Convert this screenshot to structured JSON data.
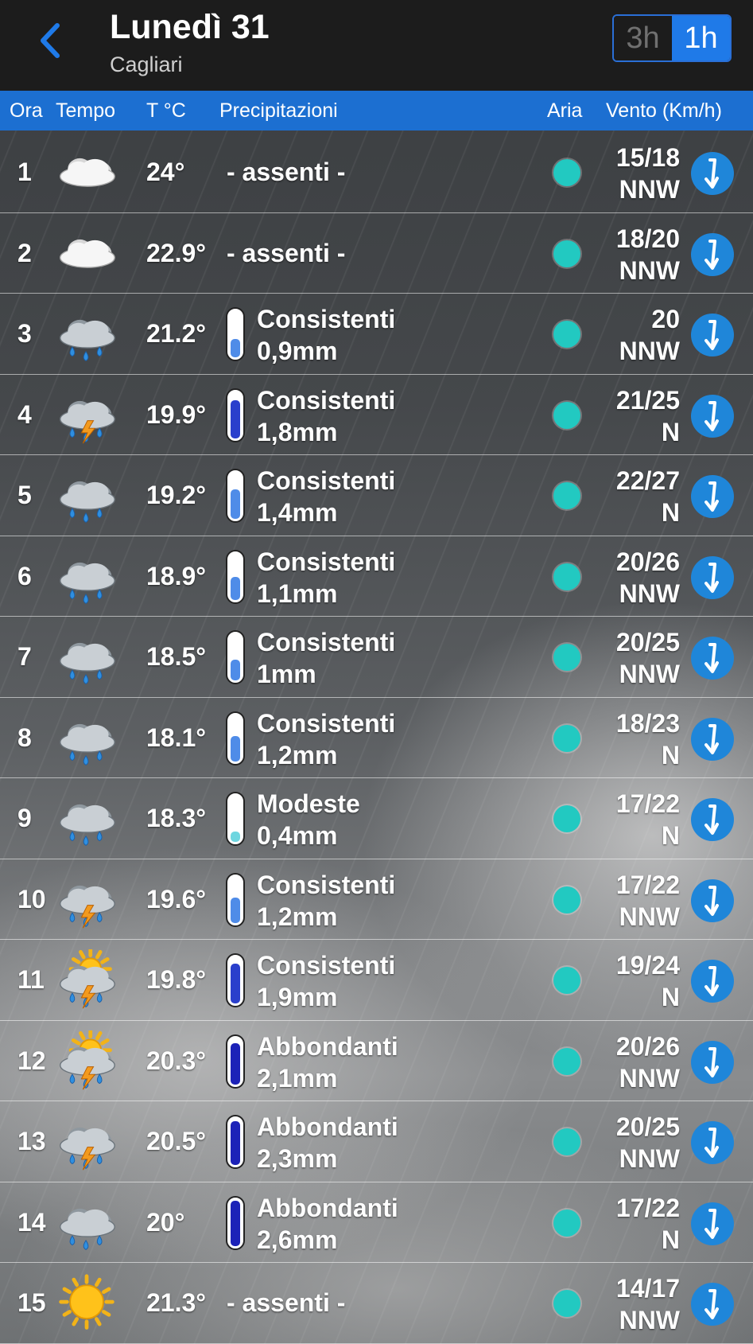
{
  "header": {
    "title": "Lunedì 31",
    "subtitle": "Cagliari",
    "interval_3h": "3h",
    "interval_1h": "1h",
    "selected_interval": "1h"
  },
  "columns": {
    "hour": "Ora",
    "weather": "Tempo",
    "temp": "T °C",
    "precip": "Precipitazioni",
    "air": "Aria",
    "wind": "Vento (Km/h)"
  },
  "colors": {
    "accent": "#1f7ae8",
    "header_bar": "#1c6fd1",
    "air_quality_good": "#22c9c1",
    "wind_badge": "#1f86d9"
  },
  "rows": [
    {
      "hour": "1",
      "icon": "cloudy-icon",
      "temp": "24°",
      "precip_label": "- assenti -",
      "precip_amount": "",
      "level": 0,
      "wind_speed": "15/18",
      "wind_dir": "NNW"
    },
    {
      "hour": "2",
      "icon": "cloudy-icon",
      "temp": "22.9°",
      "precip_label": "- assenti -",
      "precip_amount": "",
      "level": 0,
      "wind_speed": "18/20",
      "wind_dir": "NNW"
    },
    {
      "hour": "3",
      "icon": "rain-icon",
      "temp": "21.2°",
      "precip_label": "Consistenti",
      "precip_amount": "0,9mm",
      "level": 0.4,
      "wind_speed": "20",
      "wind_dir": "NNW"
    },
    {
      "hour": "4",
      "icon": "thunderstorm-rain-icon",
      "temp": "19.9°",
      "precip_label": "Consistenti",
      "precip_amount": "1,8mm",
      "level": 0.82,
      "wind_speed": "21/25",
      "wind_dir": "N"
    },
    {
      "hour": "5",
      "icon": "rain-icon",
      "temp": "19.2°",
      "precip_label": "Consistenti",
      "precip_amount": "1,4mm",
      "level": 0.63,
      "wind_speed": "22/27",
      "wind_dir": "N"
    },
    {
      "hour": "6",
      "icon": "rain-icon",
      "temp": "18.9°",
      "precip_label": "Consistenti",
      "precip_amount": "1,1mm",
      "level": 0.5,
      "wind_speed": "20/26",
      "wind_dir": "NNW"
    },
    {
      "hour": "7",
      "icon": "rain-icon",
      "temp": "18.5°",
      "precip_label": "Consistenti",
      "precip_amount": "1mm",
      "level": 0.45,
      "wind_speed": "20/25",
      "wind_dir": "NNW"
    },
    {
      "hour": "8",
      "icon": "rain-icon",
      "temp": "18.1°",
      "precip_label": "Consistenti",
      "precip_amount": "1,2mm",
      "level": 0.55,
      "wind_speed": "18/23",
      "wind_dir": "N"
    },
    {
      "hour": "9",
      "icon": "rain-icon",
      "temp": "18.3°",
      "precip_label": "Modeste",
      "precip_amount": "0,4mm",
      "level": 0.22,
      "wind_speed": "17/22",
      "wind_dir": "N"
    },
    {
      "hour": "10",
      "icon": "thunderstorm-rain-icon",
      "temp": "19.6°",
      "precip_label": "Consistenti",
      "precip_amount": "1,2mm",
      "level": 0.55,
      "wind_speed": "17/22",
      "wind_dir": "NNW"
    },
    {
      "hour": "11",
      "icon": "sun-thunderstorm-rain-icon",
      "temp": "19.8°",
      "precip_label": "Consistenti",
      "precip_amount": "1,9mm",
      "level": 0.86,
      "wind_speed": "19/24",
      "wind_dir": "N"
    },
    {
      "hour": "12",
      "icon": "sun-thunderstorm-rain-icon",
      "temp": "20.3°",
      "precip_label": "Abbondanti",
      "precip_amount": "2,1mm",
      "level": 0.9,
      "wind_speed": "20/26",
      "wind_dir": "NNW"
    },
    {
      "hour": "13",
      "icon": "thunderstorm-rain-icon",
      "temp": "20.5°",
      "precip_label": "Abbondanti",
      "precip_amount": "2,3mm",
      "level": 0.94,
      "wind_speed": "20/25",
      "wind_dir": "NNW"
    },
    {
      "hour": "14",
      "icon": "rain-icon",
      "temp": "20°",
      "precip_label": "Abbondanti",
      "precip_amount": "2,6mm",
      "level": 0.98,
      "wind_speed": "17/22",
      "wind_dir": "N"
    },
    {
      "hour": "15",
      "icon": "sun-icon",
      "temp": "21.3°",
      "precip_label": "- assenti -",
      "precip_amount": "",
      "level": 0,
      "wind_speed": "14/17",
      "wind_dir": "NNW"
    }
  ]
}
